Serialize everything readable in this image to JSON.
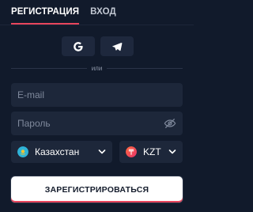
{
  "tabs": {
    "register_label": "РЕГИСТРАЦИЯ",
    "login_label": "ВХОД"
  },
  "social": {
    "google_icon": "google-icon",
    "telegram_icon": "telegram-icon"
  },
  "divider": {
    "or_label": "или"
  },
  "form": {
    "email": {
      "placeholder": "E-mail",
      "value": ""
    },
    "password": {
      "placeholder": "Пароль",
      "value": ""
    },
    "country": {
      "value": "Казахстан",
      "flag_icon": "kazakhstan-flag-icon"
    },
    "currency": {
      "value": "KZT",
      "flag_icon": "currency-flag-icon"
    }
  },
  "submit_label": "ЗАРЕГИСТРИРОВАТЬСЯ",
  "colors": {
    "background": "#111a2b",
    "field_bg": "#1d273a",
    "accent": "#e8455c",
    "text": "#ffffff",
    "muted": "#7f899c"
  }
}
